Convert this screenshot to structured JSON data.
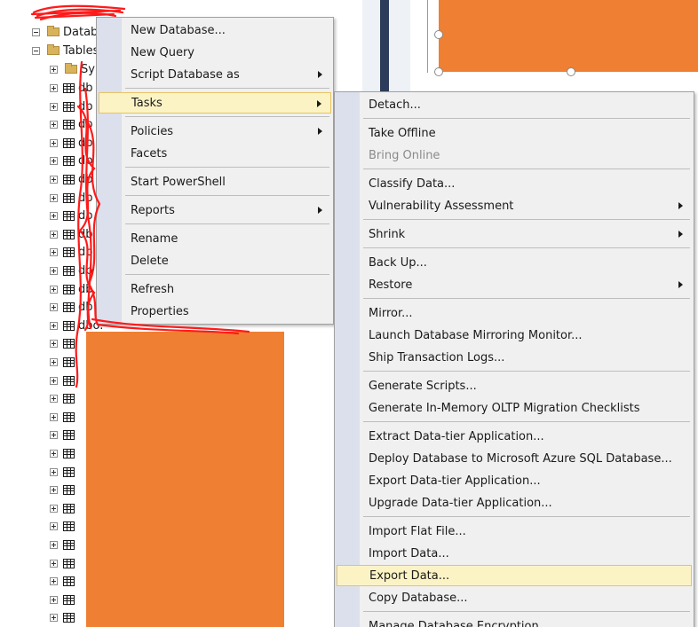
{
  "colors": {
    "accent_orange": "#ee7f33",
    "menu_highlight": "#fcf3c5",
    "menu_highlight_border": "#e5c365",
    "scribble_red": "#ff1a1a"
  },
  "tree": {
    "folder_databases": "Datab",
    "folder_tables": "Tables",
    "folder_system": "Sy",
    "rows": [
      "db",
      "db",
      "db",
      "db",
      "db",
      "db",
      "db",
      "db",
      "db",
      "db",
      "db",
      "db",
      "db",
      "dbo.",
      ""
    ]
  },
  "context_menu": {
    "items": [
      {
        "label": "New Database..."
      },
      {
        "label": "New Query"
      },
      {
        "label": "Script Database as"
      },
      {
        "label": "Tasks"
      },
      {
        "label": "Policies"
      },
      {
        "label": "Facets"
      },
      {
        "label": "Start PowerShell"
      },
      {
        "label": "Reports"
      },
      {
        "label": "Rename"
      },
      {
        "label": "Delete"
      },
      {
        "label": "Refresh"
      },
      {
        "label": "Properties"
      }
    ]
  },
  "tasks_menu": {
    "items": [
      {
        "label": "Detach..."
      },
      {
        "label": "Take Offline"
      },
      {
        "label": "Bring Online"
      },
      {
        "label": "Classify Data..."
      },
      {
        "label": "Vulnerability Assessment"
      },
      {
        "label": "Shrink"
      },
      {
        "label": "Back Up..."
      },
      {
        "label": "Restore"
      },
      {
        "label": "Mirror..."
      },
      {
        "label": "Launch Database Mirroring Monitor..."
      },
      {
        "label": "Ship Transaction Logs..."
      },
      {
        "label": "Generate Scripts..."
      },
      {
        "label": "Generate In-Memory OLTP Migration Checklists"
      },
      {
        "label": "Extract Data-tier Application..."
      },
      {
        "label": "Deploy Database to Microsoft Azure SQL Database..."
      },
      {
        "label": "Export Data-tier Application..."
      },
      {
        "label": "Upgrade Data-tier Application..."
      },
      {
        "label": "Import Flat File..."
      },
      {
        "label": "Import Data..."
      },
      {
        "label": "Export Data..."
      },
      {
        "label": "Copy Database..."
      },
      {
        "label": "Manage Database Encryption..."
      }
    ]
  }
}
